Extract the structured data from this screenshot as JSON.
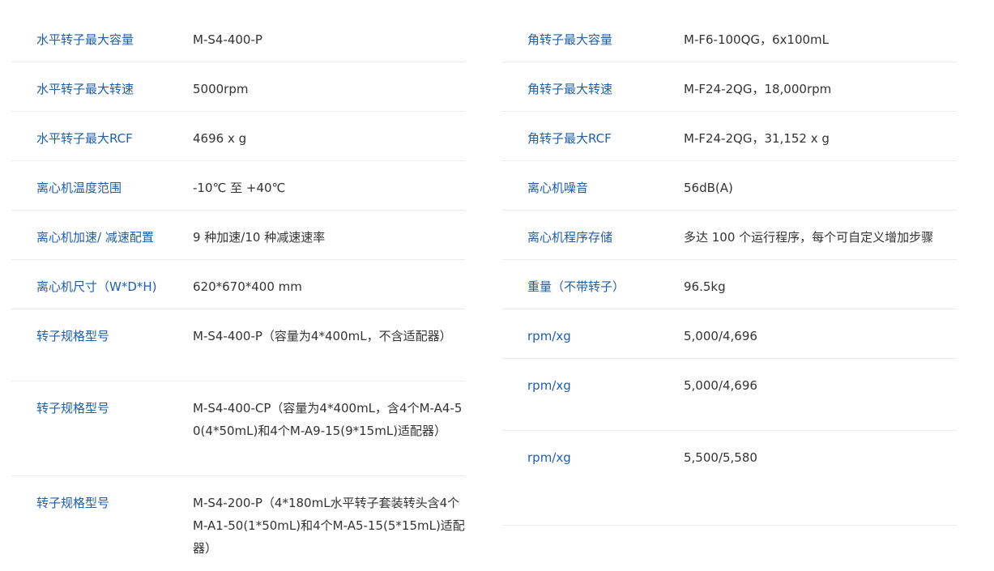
{
  "left_rows": [
    {
      "label": "水平转子最大容量",
      "value": "M-S4-400-P"
    },
    {
      "label": "水平转子最大转速",
      "value": "5000rpm"
    },
    {
      "label": "水平转子最大RCF",
      "value": "4696 x g"
    },
    {
      "label": "离心机温度范围",
      "value": "-10℃ 至 +40℃"
    },
    {
      "label": "离心机加速/ 减速配置",
      "value": "9 种加速/10 种减速速率"
    },
    {
      "label": "离心机尺寸（W*D*H)",
      "value": "620*670*400 mm"
    },
    {
      "label": "转子规格型号",
      "value": "M-S4-400-P（容量为4*400mL，不含适配器）"
    },
    {
      "label": "转子规格型号",
      "value": "M-S4-400-CP（容量为4*400mL，含4个M-A4-50(4*50mL)和4个M-A9-15(9*15mL)适配器）"
    },
    {
      "label": "转子规格型号",
      "value": "M-S4-200-P（4*180mL水平转子套装转头含4个M-A1-50(1*50mL)和4个M-A5-15(5*15mL)适配器）"
    }
  ],
  "right_rows": [
    {
      "label": "角转子最大容量",
      "value": "M-F6-100QG，6x100mL"
    },
    {
      "label": "角转子最大转速",
      "value": "M-F24-2QG，18,000rpm"
    },
    {
      "label": "角转子最大RCF",
      "value": "M-F24-2QG，31,152 x g"
    },
    {
      "label": "离心机噪音",
      "value": "56dB(A)"
    },
    {
      "label": "离心机程序存储",
      "value": "多达 100 个运行程序，每个可自定义增加步骤"
    },
    {
      "label": "重量（不带转子）",
      "value": "96.5kg"
    },
    {
      "label": "rpm/xg",
      "value": "5,000/4,696"
    },
    {
      "label": "rpm/xg",
      "value": "5,000/4,696"
    },
    {
      "label": "rpm/xg",
      "value": "5,500/5,580"
    }
  ]
}
